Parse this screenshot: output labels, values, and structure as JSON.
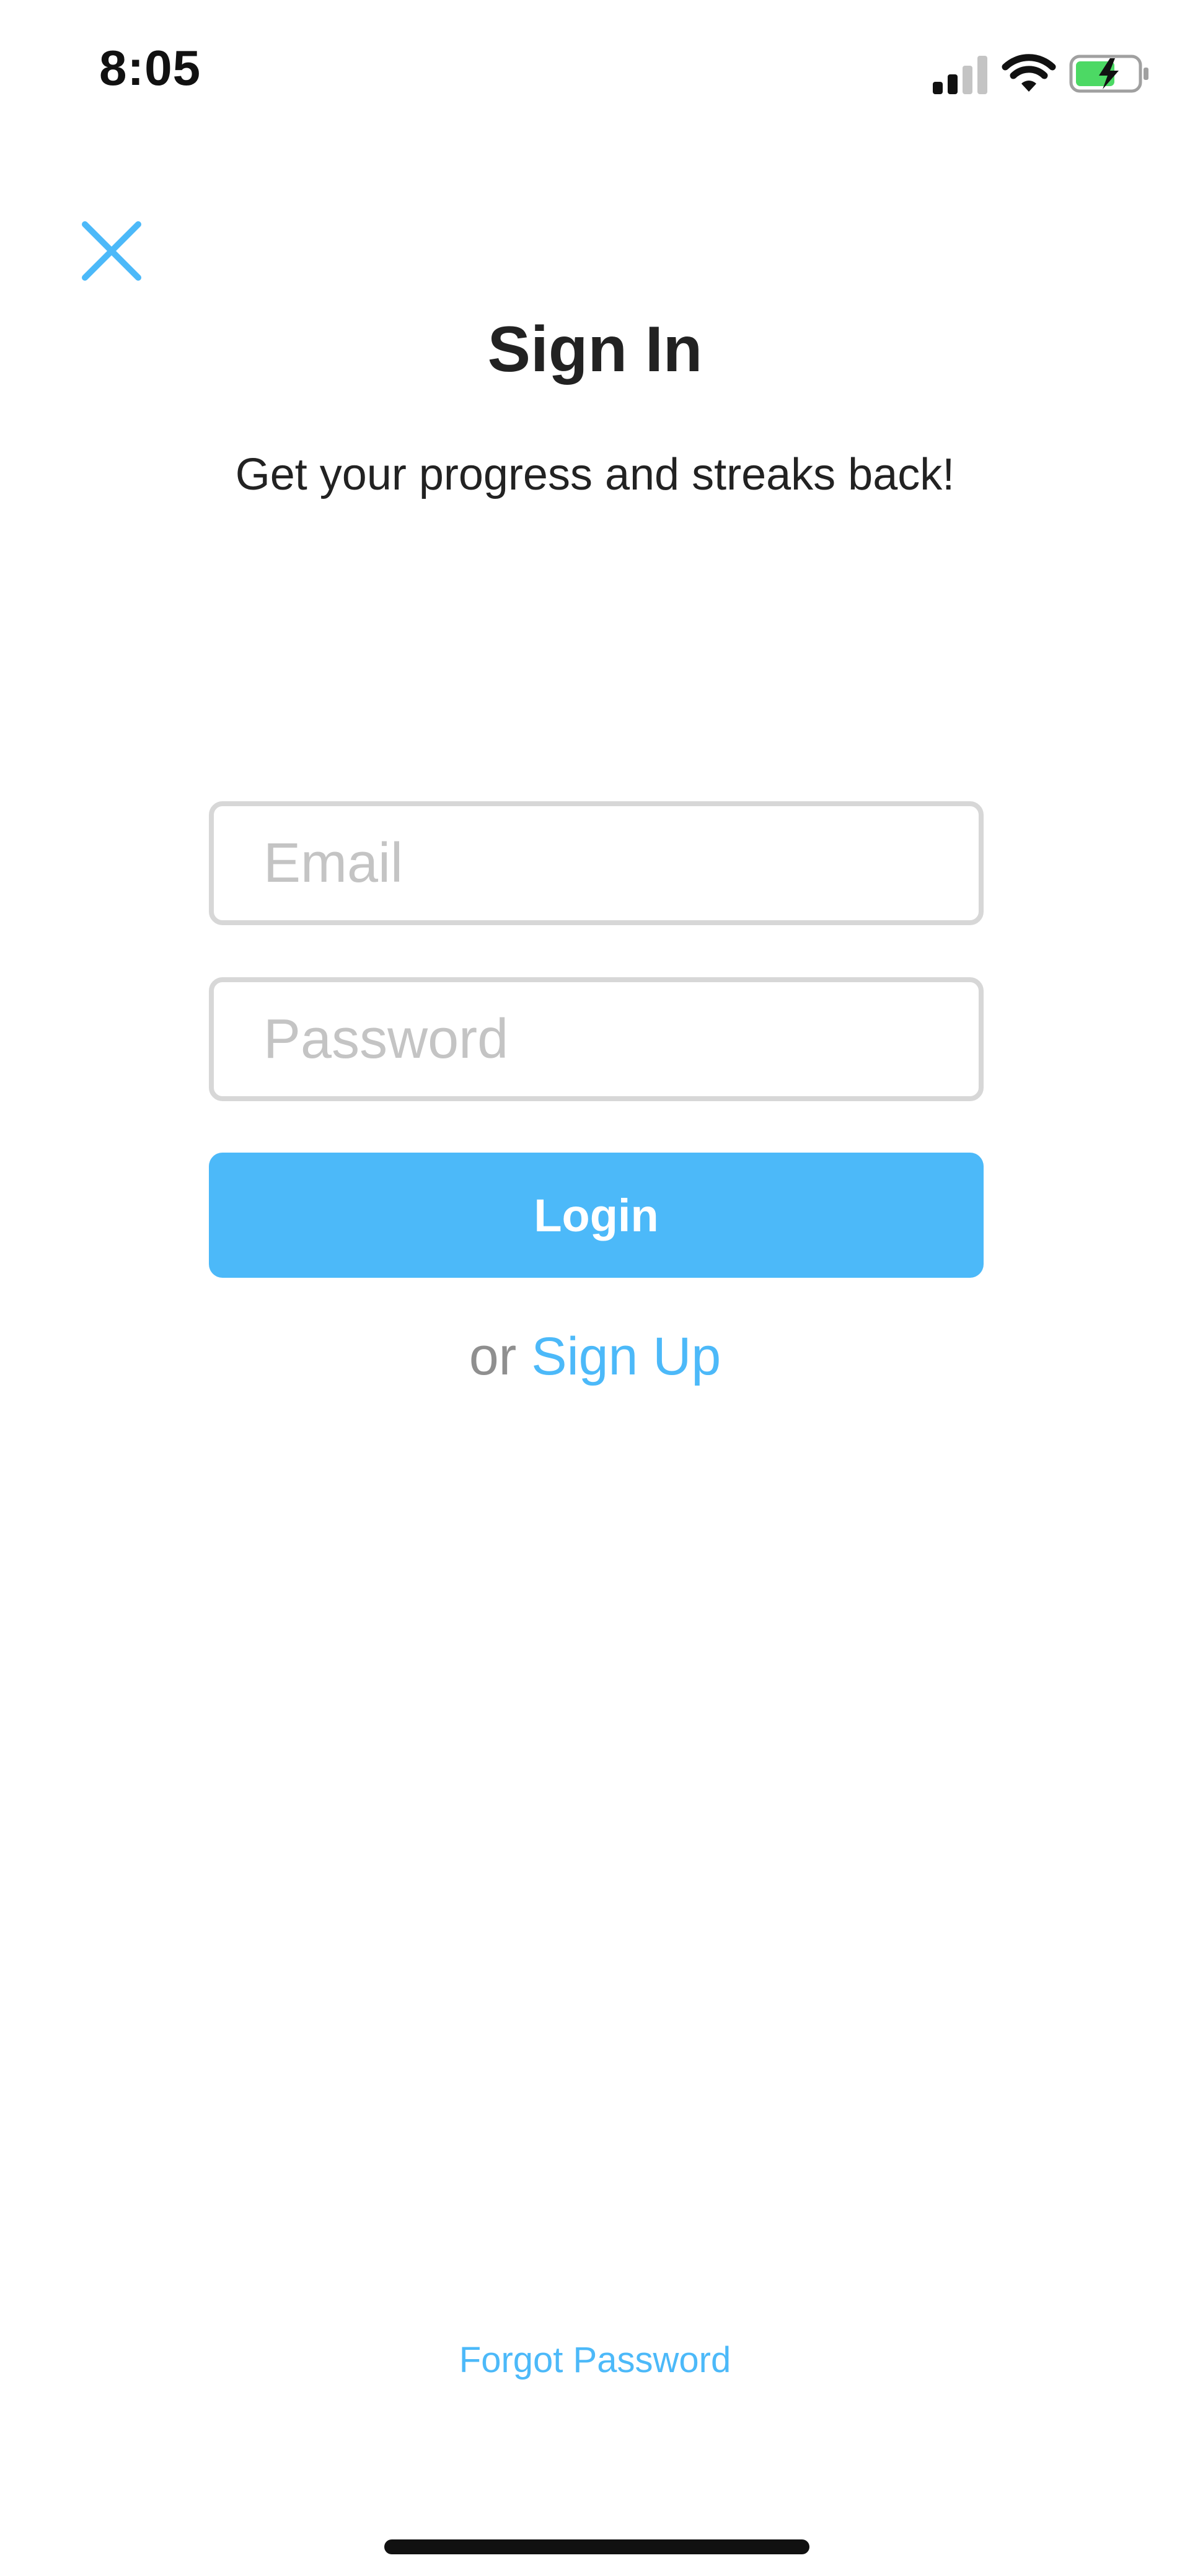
{
  "status_bar": {
    "time": "8:05",
    "signal_icon": "cellular-signal-icon",
    "wifi_icon": "wifi-icon",
    "battery_icon": "battery-charging-icon"
  },
  "header": {
    "close_icon": "close-icon",
    "title": "Sign In",
    "subtitle": "Get your progress and streaks back!"
  },
  "form": {
    "email_placeholder": "Email",
    "email_value": "",
    "password_placeholder": "Password",
    "password_value": "",
    "login_label": "Login"
  },
  "signup": {
    "prefix": "or",
    "link_label": "Sign Up"
  },
  "footer": {
    "forgot_password_label": "Forgot Password"
  },
  "colors": {
    "accent": "#4cb9f9",
    "text": "#222222",
    "muted": "#8f8f8f",
    "field_border": "#d7d7d7",
    "battery_green": "#4cd964"
  }
}
